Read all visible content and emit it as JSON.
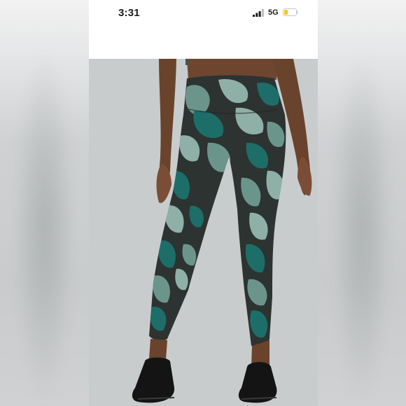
{
  "status_bar": {
    "time": "3:31",
    "network": "5G",
    "signal_icon": "cellular-signal-icon",
    "battery_icon": "battery-low-icon",
    "battery_color": "#f5c518"
  },
  "photo": {
    "subject": "model-wearing-camo-leggings",
    "colors": {
      "teal": "#1d6e68",
      "dark": "#2c3331",
      "sage": "#8fb0a6",
      "mint": "#6b958b",
      "skin": "#7a4e36",
      "shoe": "#141414",
      "background": "#c9cccd"
    }
  }
}
